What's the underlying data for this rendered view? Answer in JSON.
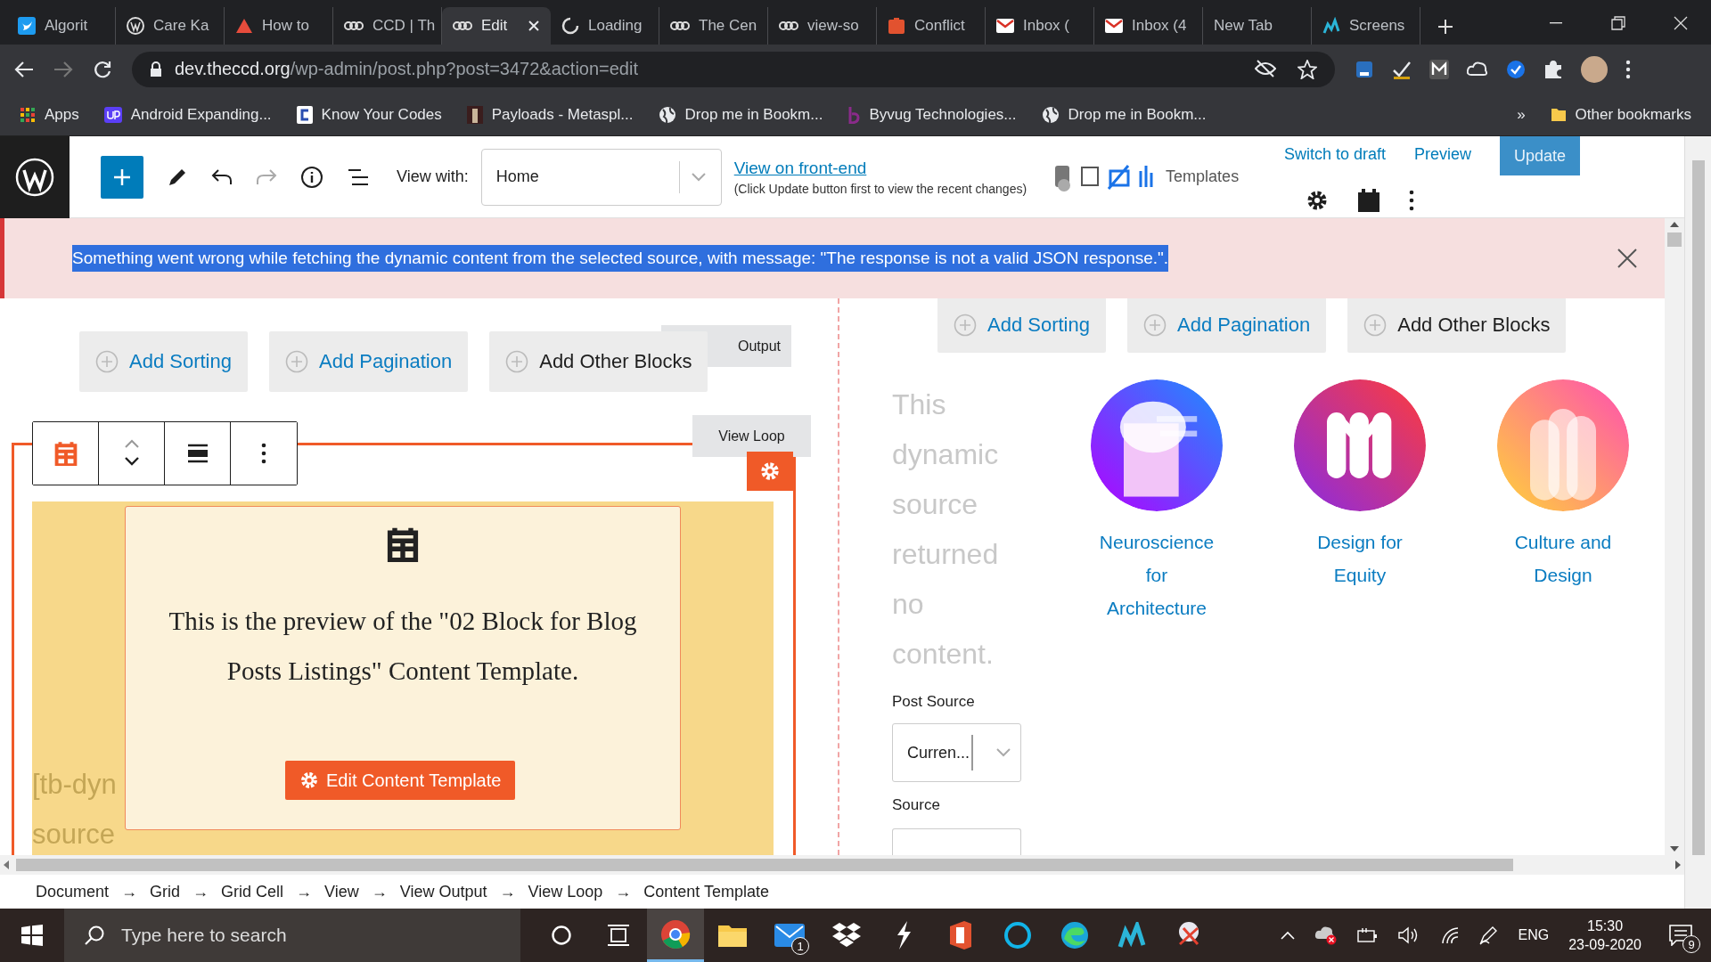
{
  "browser": {
    "tabs": [
      {
        "title": "Algorit",
        "kind": "bird",
        "selected": false
      },
      {
        "title": "Care Ka",
        "kind": "wp",
        "selected": false
      },
      {
        "title": "How to",
        "kind": "triangle",
        "selected": false
      },
      {
        "title": "CCD | Th",
        "kind": "ccd",
        "selected": false
      },
      {
        "title": "Edit",
        "kind": "ccd",
        "selected": true
      },
      {
        "title": "Loading",
        "kind": "spinner",
        "selected": false
      },
      {
        "title": "The Cen",
        "kind": "ccd",
        "selected": false
      },
      {
        "title": "view-so",
        "kind": "ccd",
        "selected": false
      },
      {
        "title": "Conflict",
        "kind": "office",
        "selected": false
      },
      {
        "title": "Inbox (",
        "kind": "mail",
        "selected": false
      },
      {
        "title": "Inbox (4",
        "kind": "mail",
        "selected": false
      },
      {
        "title": "New Tab",
        "kind": "blank",
        "selected": false
      },
      {
        "title": "Screens",
        "kind": "chart",
        "selected": false
      }
    ],
    "address": {
      "host": "dev.theccd.org",
      "path": "/wp-admin/post.php?post=3472&action=edit"
    },
    "bookmarks": [
      {
        "label": "Apps",
        "kind": "grid"
      },
      {
        "label": "Android Expanding...",
        "kind": "up"
      },
      {
        "label": "Know Your Codes",
        "kind": "code"
      },
      {
        "label": "Payloads - Metaspl...",
        "kind": "figure"
      },
      {
        "label": "Drop me in Bookm...",
        "kind": "globe"
      },
      {
        "label": "Byvug Technologies...",
        "kind": "b"
      },
      {
        "label": "Drop me in Bookm...",
        "kind": "globe"
      }
    ],
    "overflow": "»",
    "other_bookmarks": "Other bookmarks"
  },
  "editor_toolbar": {
    "view_with_label": "View with:",
    "view_with_value": "Home",
    "front_end_link": "View on front-end",
    "front_end_note": "(Click Update button first to view the recent changes)",
    "templates_label": "Templates",
    "switch_to_draft": "Switch to draft",
    "preview": "Preview",
    "update": "Update"
  },
  "notice": {
    "message": "Something went wrong while fetching the dynamic content from the selected source, with message: \"The response is not a valid JSON response.\".",
    "selected": true
  },
  "left_pane": {
    "add_buttons": [
      {
        "label": "Add Sorting",
        "kind": "link"
      },
      {
        "label": "Add Pagination",
        "kind": "link"
      },
      {
        "label": "Add Other Blocks",
        "kind": "plain"
      }
    ],
    "output_tag": "Output",
    "view_loop_tag": "View Loop",
    "template_preview": {
      "text": "This is the preview of the \"02 Block for Blog Posts Listings\" Content Template.",
      "button": "Edit Content Template"
    },
    "shortcode_lines": [
      "[tb-dyn",
      "source"
    ]
  },
  "right_pane": {
    "add_buttons": [
      {
        "label": "Add Sorting",
        "kind": "link"
      },
      {
        "label": "Add Pagination",
        "kind": "link"
      },
      {
        "label": "Add Other Blocks",
        "kind": "plain"
      }
    ],
    "empty_message": "This dynamic source returned no content.",
    "post_source_label": "Post Source",
    "post_source_value": "Curren...",
    "source_label": "Source",
    "posts": [
      {
        "title": "Neuroscience for Architecture",
        "kind": "picture"
      },
      {
        "title": "Design for Equity",
        "kind": "picture"
      },
      {
        "title": "Culture and Design",
        "kind": "picture"
      }
    ]
  },
  "breadcrumb": [
    {
      "label": "Document",
      "arrow": "→"
    },
    {
      "label": "Grid",
      "arrow": "→"
    },
    {
      "label": "Grid Cell",
      "arrow": "→"
    },
    {
      "label": "View",
      "arrow": "→"
    },
    {
      "label": "View Output",
      "arrow": "→"
    },
    {
      "label": "View Loop",
      "arrow": "→"
    },
    {
      "label": "Content Template"
    }
  ],
  "taskbar": {
    "search_placeholder": "Type here to search",
    "apps": [
      {
        "kind": "chrome",
        "selected": true
      },
      {
        "kind": "folder",
        "selected": false
      },
      {
        "kind": "mail",
        "selected": false,
        "badge": "1"
      },
      {
        "kind": "dropbox",
        "selected": false
      },
      {
        "kind": "bolt",
        "selected": false
      },
      {
        "kind": "office",
        "selected": false
      },
      {
        "kind": "ring",
        "selected": false
      },
      {
        "kind": "edge",
        "selected": false
      },
      {
        "kind": "chart",
        "selected": false
      },
      {
        "kind": "snip",
        "selected": false
      }
    ],
    "language": "ENG",
    "time": "15:30",
    "date": "23-09-2020",
    "notifications": "9"
  }
}
